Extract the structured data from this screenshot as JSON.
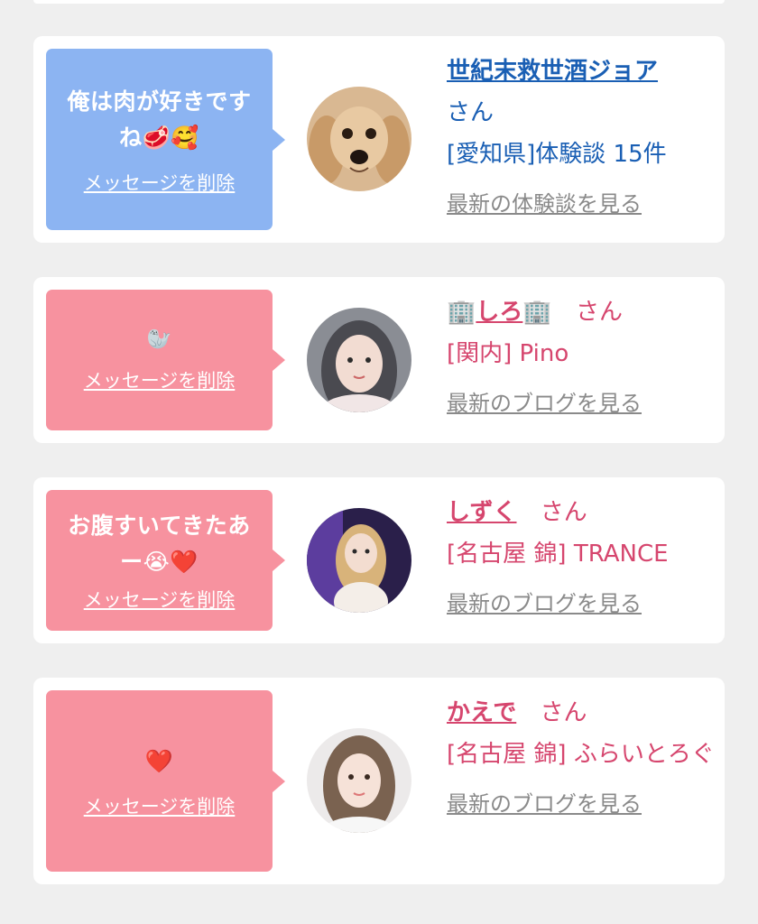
{
  "cards": [
    {
      "message": "俺は肉が好きですね🥩🥰",
      "delete_label": "メッセージを削除",
      "name": "世紀末救世酒ジョア",
      "honorific": "さん",
      "detail": "[愛知県]体験談 15件",
      "latest_label": "最新の体験談を見る",
      "avatar_icon": "dog-photo"
    },
    {
      "message": "🦭",
      "delete_label": "メッセージを削除",
      "name": "しろ",
      "name_decor": "🏢",
      "honorific": "さん",
      "detail": "[関内] Pino",
      "latest_label": "最新のブログを見る",
      "avatar_icon": "woman-photo"
    },
    {
      "message": "お腹すいてきたあー😭❤️",
      "delete_label": "メッセージを削除",
      "name": "しずく",
      "honorific": "さん",
      "detail": "[名古屋 錦] TRANCE",
      "latest_label": "最新のブログを見る",
      "avatar_icon": "woman-photo"
    },
    {
      "message": "❤️",
      "delete_label": "メッセージを削除",
      "name": "かえで",
      "honorific": "さん",
      "detail": "[名古屋 錦] ふらいとろぐ",
      "latest_label": "最新のブログを見る",
      "avatar_icon": "woman-photo"
    }
  ],
  "colors": {
    "accent_blue": "#1a5fb4",
    "accent_pink": "#d6466e",
    "bubble_blue": "#8cb4f2",
    "bubble_pink": "#f7929f"
  }
}
